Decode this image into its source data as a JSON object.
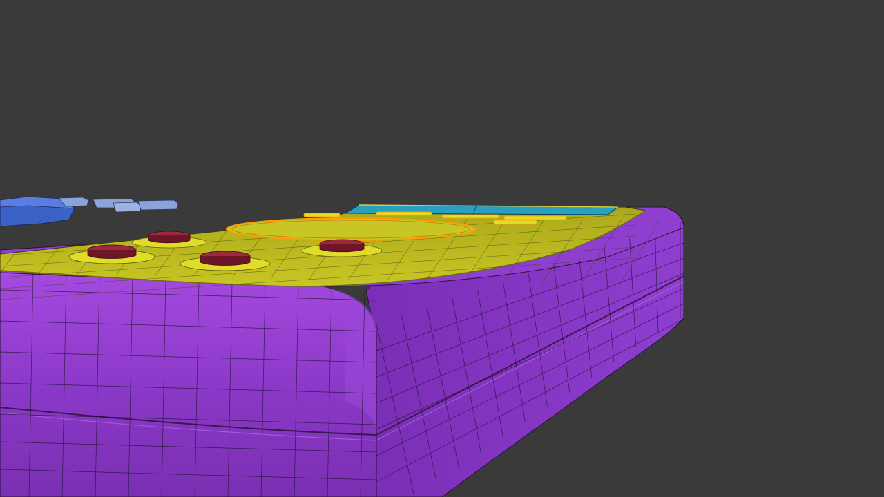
{
  "viewport": {
    "background_color": "#3a3a3a",
    "wire_color": "#1c1026",
    "overlay_text": ""
  },
  "model": {
    "body_color": "#8b3ccc",
    "body_dark_color": "#6c2aa6",
    "faceplate_color": "#bdbd1f",
    "faceplate_dark_color": "#9e9c16",
    "screen_color": "#2aa0c0",
    "selection_highlight_color": "#ff9a00",
    "button_red_color": "#9a2a3c",
    "button_red_dark_color": "#6e1628",
    "button_ring_color": "#e0dc2a",
    "blue_part_color": "#3b62c6",
    "lightblue_part_color": "#8aa3d8"
  }
}
